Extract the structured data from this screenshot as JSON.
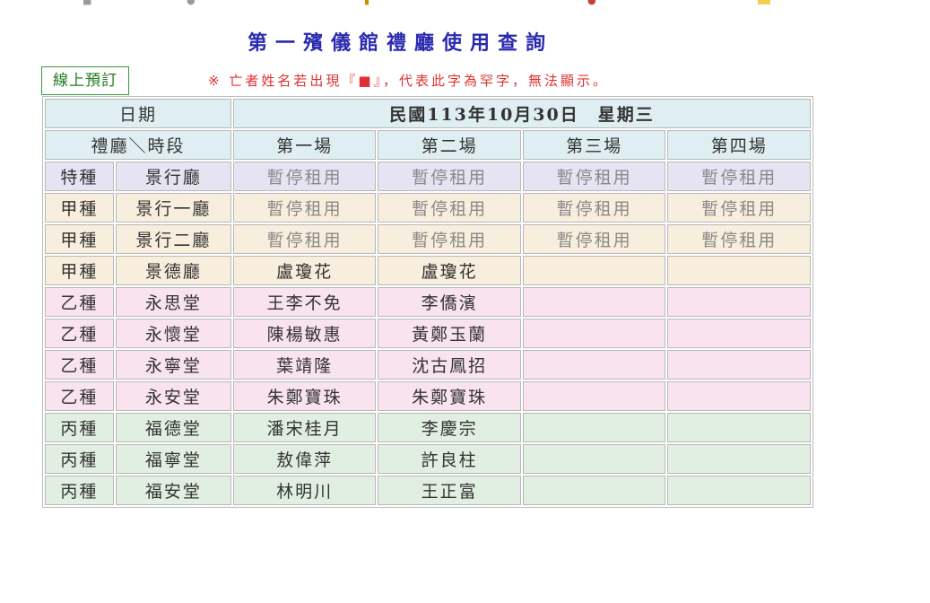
{
  "page_title": "第一殯儀館禮廳使用查詢",
  "booking_button": "線上預訂",
  "notice": "※ 亡者姓名若出現『■』，代表此字為罕字，無法顯示。",
  "table": {
    "date_label": "日期",
    "date_value": "民國113年10月30日　星期三",
    "hall_time_label": "禮廳＼時段",
    "sessions": [
      "第一場",
      "第二場",
      "第三場",
      "第四場"
    ],
    "rows": [
      {
        "grade": "特種",
        "hall": "景行廳",
        "s1": "暫停租用",
        "s2": "暫停租用",
        "s3": "暫停租用",
        "s4": "暫停租用"
      },
      {
        "grade": "甲種",
        "hall": "景行一廳",
        "s1": "暫停租用",
        "s2": "暫停租用",
        "s3": "暫停租用",
        "s4": "暫停租用"
      },
      {
        "grade": "甲種",
        "hall": "景行二廳",
        "s1": "暫停租用",
        "s2": "暫停租用",
        "s3": "暫停租用",
        "s4": "暫停租用"
      },
      {
        "grade": "甲種",
        "hall": "景德廳",
        "s1": "盧瓊花",
        "s2": "盧瓊花",
        "s3": "",
        "s4": ""
      },
      {
        "grade": "乙種",
        "hall": "永思堂",
        "s1": "王李不免",
        "s2": "李僑濱",
        "s3": "",
        "s4": ""
      },
      {
        "grade": "乙種",
        "hall": "永懷堂",
        "s1": "陳楊敏惠",
        "s2": "黃鄭玉蘭",
        "s3": "",
        "s4": ""
      },
      {
        "grade": "乙種",
        "hall": "永寧堂",
        "s1": "葉靖隆",
        "s2": "沈古鳳招",
        "s3": "",
        "s4": ""
      },
      {
        "grade": "乙種",
        "hall": "永安堂",
        "s1": "朱鄭寶珠",
        "s2": "朱鄭寶珠",
        "s3": "",
        "s4": ""
      },
      {
        "grade": "丙種",
        "hall": "福德堂",
        "s1": "潘宋桂月",
        "s2": "李慶宗",
        "s3": "",
        "s4": ""
      },
      {
        "grade": "丙種",
        "hall": "福寧堂",
        "s1": "敖偉萍",
        "s2": "許良柱",
        "s3": "",
        "s4": ""
      },
      {
        "grade": "丙種",
        "hall": "福安堂",
        "s1": "林明川",
        "s2": "王正富",
        "s3": "",
        "s4": ""
      }
    ]
  },
  "colors": {
    "title": "#2a2ab0",
    "notice": "#e03030",
    "header_bg": "#dfeef3",
    "special_row_bg": "#e6e3f2",
    "grade_a_bg": "#f8eedd",
    "grade_b_bg": "#f8e3ee",
    "grade_c_bg": "#e1efe1"
  }
}
